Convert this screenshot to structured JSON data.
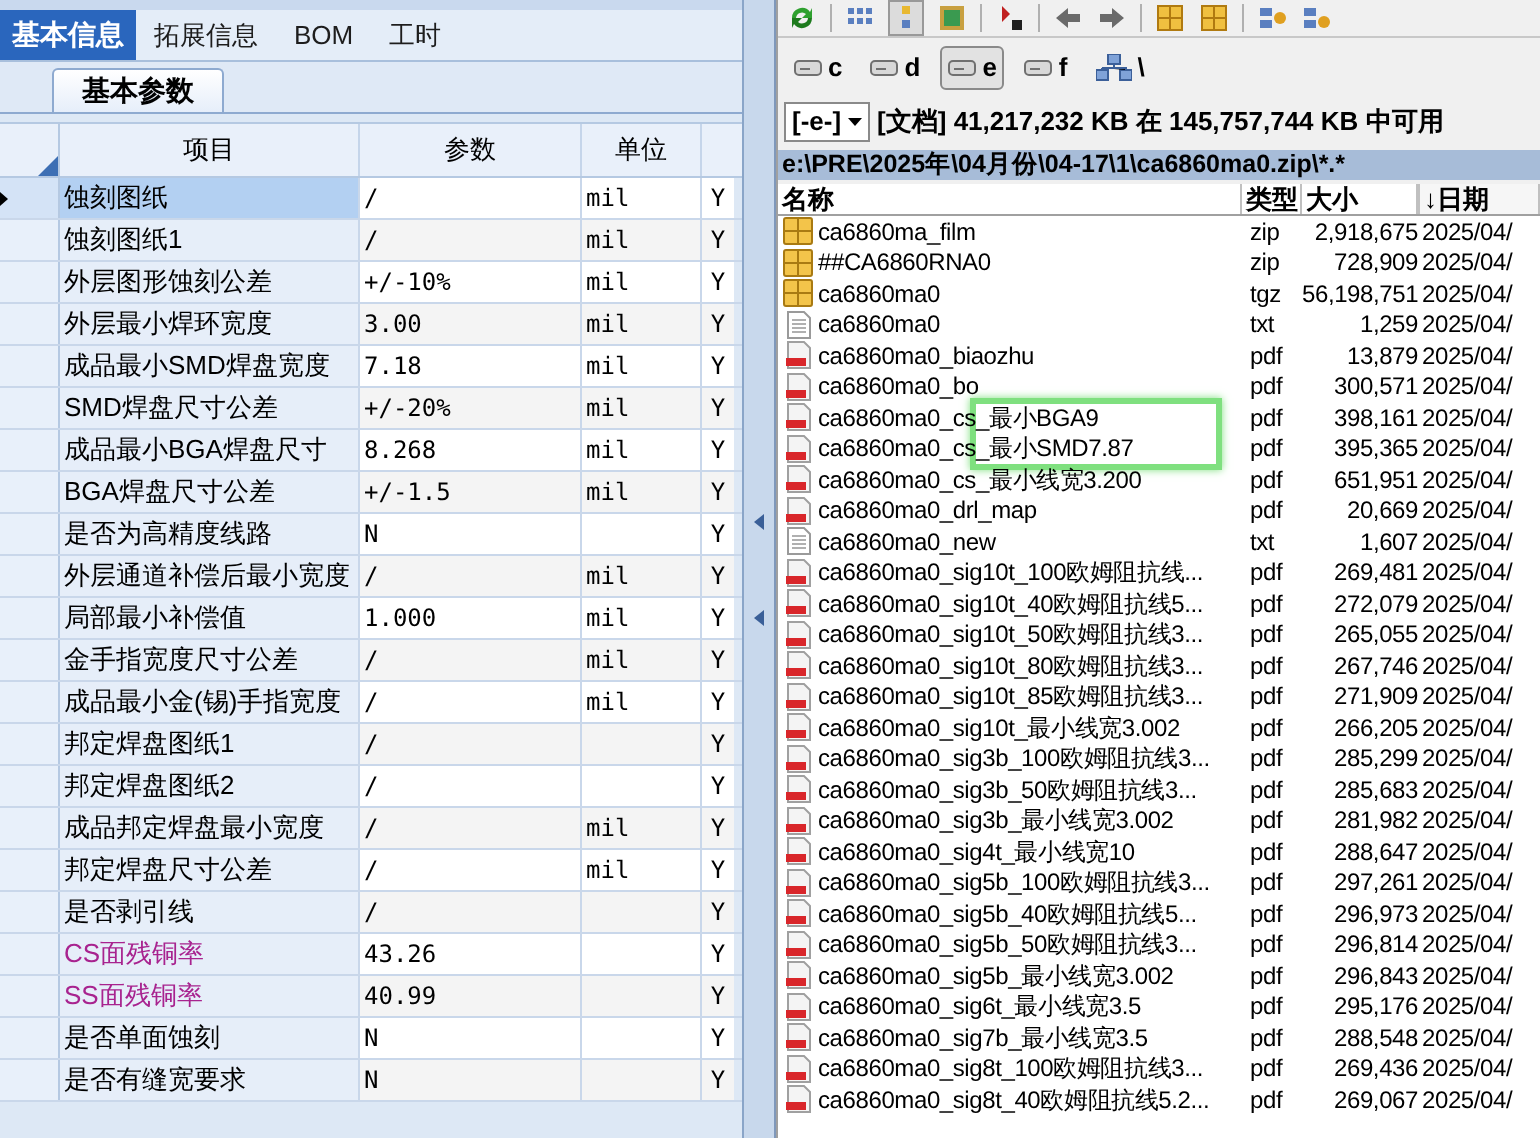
{
  "left_panel": {
    "tabs": [
      {
        "label": "基本信息",
        "selected": true
      },
      {
        "label": "拓展信息",
        "selected": false
      },
      {
        "label": "BOM",
        "selected": false
      },
      {
        "label": "工时",
        "selected": false
      }
    ],
    "subtabs": [
      {
        "label": "基本参数",
        "selected": true
      }
    ],
    "table": {
      "columns": [
        "项目",
        "参数",
        "单位"
      ],
      "rows": [
        {
          "item": "蚀刻图纸",
          "value": "/",
          "unit": "mil",
          "column_4": "Y",
          "color": "#000000",
          "selected": true
        },
        {
          "item": "蚀刻图纸1",
          "value": "/",
          "unit": "mil",
          "column_4": "Y",
          "color": "#000000",
          "selected": false
        },
        {
          "item": "外层图形蚀刻公差",
          "value": "+/-10%",
          "unit": "mil",
          "column_4": "Y",
          "color": "#000000",
          "selected": false
        },
        {
          "item": "外层最小焊环宽度",
          "value": "3.00",
          "unit": "mil",
          "column_4": "Y",
          "color": "#000000",
          "selected": false
        },
        {
          "item": "成品最小SMD焊盘宽度",
          "value": "7.18",
          "unit": "mil",
          "column_4": "Y",
          "color": "#000000",
          "selected": false
        },
        {
          "item": "SMD焊盘尺寸公差",
          "value": "+/-20%",
          "unit": "mil",
          "column_4": "Y",
          "color": "#000000",
          "selected": false
        },
        {
          "item": "成品最小BGA焊盘尺寸",
          "value": "8.268",
          "unit": "mil",
          "column_4": "Y",
          "color": "#000000",
          "selected": false
        },
        {
          "item": "BGA焊盘尺寸公差",
          "value": "+/-1.5",
          "unit": "mil",
          "column_4": "Y",
          "color": "#000000",
          "selected": false
        },
        {
          "item": "是否为高精度线路",
          "value": "N",
          "column_4": "Y",
          "color": "#000000",
          "selected": false
        },
        {
          "item": "外层通道补偿后最小宽度",
          "value": "/",
          "unit": "mil",
          "column_4": "Y",
          "color": "#000000",
          "selected": false
        },
        {
          "item": "局部最小补偿值",
          "value": "1.000",
          "unit": "mil",
          "column_4": "Y",
          "color": "#000000",
          "selected": false
        },
        {
          "item": "金手指宽度尺寸公差",
          "value": "/",
          "unit": "mil",
          "column_4": "Y",
          "color": "#000000",
          "selected": false
        },
        {
          "item": "成品最小金(锡)手指宽度",
          "value": "/",
          "unit": "mil",
          "column_4": "Y",
          "color": "#000000",
          "selected": false
        },
        {
          "item": "邦定焊盘图纸1",
          "value": "/",
          "column_4": "Y",
          "color": "#000000",
          "selected": false
        },
        {
          "item": "邦定焊盘图纸2",
          "value": "/",
          "column_4": "Y",
          "color": "#000000",
          "selected": false
        },
        {
          "item": "成品邦定焊盘最小宽度",
          "value": "/",
          "unit": "mil",
          "column_4": "Y",
          "color": "#000000",
          "selected": false
        },
        {
          "item": "邦定焊盘尺寸公差",
          "value": "/",
          "unit": "mil",
          "column_4": "Y",
          "color": "#000000",
          "selected": false
        },
        {
          "item": "是否剥引线",
          "value": "/",
          "column_4": "Y",
          "color": "#000000",
          "selected": false
        },
        {
          "item": "CS面残铜率",
          "value": "43.26",
          "column_4": "Y",
          "color": "#a8238f",
          "selected": false
        },
        {
          "item": "SS面残铜率",
          "value": "40.99",
          "column_4": "Y",
          "color": "#a8238f",
          "selected": false
        },
        {
          "item": "是否单面蚀刻",
          "value": "N",
          "column_4": "Y",
          "color": "#000000",
          "selected": false
        },
        {
          "item": "是否有缝宽要求",
          "value": "N",
          "column_4": "Y",
          "color": "#000000",
          "selected": false
        }
      ]
    }
  },
  "right_panel": {
    "drives": [
      {
        "label": "c",
        "kind": "drive",
        "selected": false
      },
      {
        "label": "d",
        "kind": "drive",
        "selected": false
      },
      {
        "label": "e",
        "kind": "drive",
        "selected": true
      },
      {
        "label": "f",
        "kind": "drive",
        "selected": false
      },
      {
        "label": "\\",
        "kind": "network",
        "selected": false
      }
    ],
    "drive_dropdown": "[-e-]",
    "free_space": "[文档] 41,217,232 KB 在 145,757,744 KB 中可用",
    "path": "e:\\PRE\\2025年\\04月份\\04-17\\1\\ca6860ma0.zip\\*.*",
    "columns": [
      "名称",
      "类型",
      "大小",
      "↓日期"
    ],
    "files": [
      {
        "kind": "zip",
        "name": "ca6860ma_film",
        "type": "zip",
        "size": "2,918,675",
        "date": "2025/04/"
      },
      {
        "kind": "zip",
        "name": "##CA6860RNA0",
        "type": "zip",
        "size": "728,909",
        "date": "2025/04/"
      },
      {
        "kind": "zip",
        "name": "ca6860ma0",
        "type": "tgz",
        "size": "56,198,751",
        "date": "2025/04/"
      },
      {
        "kind": "txt",
        "name": "ca6860ma0",
        "type": "txt",
        "size": "1,259",
        "date": "2025/04/"
      },
      {
        "kind": "pdf",
        "name": "ca6860ma0_biaozhu",
        "type": "pdf",
        "size": "13,879",
        "date": "2025/04/"
      },
      {
        "kind": "pdf",
        "name": "ca6860ma0_bo",
        "type": "pdf",
        "size": "300,571",
        "date": "2025/04/"
      },
      {
        "kind": "pdf",
        "name": "ca6860ma0_cs_最小BGA9",
        "type": "pdf",
        "size": "398,161",
        "date": "2025/04/"
      },
      {
        "kind": "pdf",
        "name": "ca6860ma0_cs_最小SMD7.87",
        "type": "pdf",
        "size": "395,365",
        "date": "2025/04/"
      },
      {
        "kind": "pdf",
        "name": "ca6860ma0_cs_最小线宽3.200",
        "type": "pdf",
        "size": "651,951",
        "date": "2025/04/"
      },
      {
        "kind": "pdf",
        "name": "ca6860ma0_drl_map",
        "type": "pdf",
        "size": "20,669",
        "date": "2025/04/"
      },
      {
        "kind": "txt",
        "name": "ca6860ma0_new",
        "type": "txt",
        "size": "1,607",
        "date": "2025/04/"
      },
      {
        "kind": "pdf",
        "name": "ca6860ma0_sig10t_100欧姆阻抗线...",
        "type": "pdf",
        "size": "269,481",
        "date": "2025/04/"
      },
      {
        "kind": "pdf",
        "name": "ca6860ma0_sig10t_40欧姆阻抗线5...",
        "type": "pdf",
        "size": "272,079",
        "date": "2025/04/"
      },
      {
        "kind": "pdf",
        "name": "ca6860ma0_sig10t_50欧姆阻抗线3...",
        "type": "pdf",
        "size": "265,055",
        "date": "2025/04/"
      },
      {
        "kind": "pdf",
        "name": "ca6860ma0_sig10t_80欧姆阻抗线3...",
        "type": "pdf",
        "size": "267,746",
        "date": "2025/04/"
      },
      {
        "kind": "pdf",
        "name": "ca6860ma0_sig10t_85欧姆阻抗线3...",
        "type": "pdf",
        "size": "271,909",
        "date": "2025/04/"
      },
      {
        "kind": "pdf",
        "name": "ca6860ma0_sig10t_最小线宽3.002",
        "type": "pdf",
        "size": "266,205",
        "date": "2025/04/"
      },
      {
        "kind": "pdf",
        "name": "ca6860ma0_sig3b_100欧姆阻抗线3...",
        "type": "pdf",
        "size": "285,299",
        "date": "2025/04/"
      },
      {
        "kind": "pdf",
        "name": "ca6860ma0_sig3b_50欧姆阻抗线3...",
        "type": "pdf",
        "size": "285,683",
        "date": "2025/04/"
      },
      {
        "kind": "pdf",
        "name": "ca6860ma0_sig3b_最小线宽3.002",
        "type": "pdf",
        "size": "281,982",
        "date": "2025/04/"
      },
      {
        "kind": "pdf",
        "name": "ca6860ma0_sig4t_最小线宽10",
        "type": "pdf",
        "size": "288,647",
        "date": "2025/04/"
      },
      {
        "kind": "pdf",
        "name": "ca6860ma0_sig5b_100欧姆阻抗线3...",
        "type": "pdf",
        "size": "297,261",
        "date": "2025/04/"
      },
      {
        "kind": "pdf",
        "name": "ca6860ma0_sig5b_40欧姆阻抗线5...",
        "type": "pdf",
        "size": "296,973",
        "date": "2025/04/"
      },
      {
        "kind": "pdf",
        "name": "ca6860ma0_sig5b_50欧姆阻抗线3...",
        "type": "pdf",
        "size": "296,814",
        "date": "2025/04/"
      },
      {
        "kind": "pdf",
        "name": "ca6860ma0_sig5b_最小线宽3.002",
        "type": "pdf",
        "size": "296,843",
        "date": "2025/04/"
      },
      {
        "kind": "pdf",
        "name": "ca6860ma0_sig6t_最小线宽3.5",
        "type": "pdf",
        "size": "295,176",
        "date": "2025/04/"
      },
      {
        "kind": "pdf",
        "name": "ca6860ma0_sig7b_最小线宽3.5",
        "type": "pdf",
        "size": "288,548",
        "date": "2025/04/"
      },
      {
        "kind": "pdf",
        "name": "ca6860ma0_sig8t_100欧姆阻抗线3...",
        "type": "pdf",
        "size": "269,436",
        "date": "2025/04/"
      },
      {
        "kind": "pdf",
        "name": "ca6860ma0_sig8t_40欧姆阻抗线5.2...",
        "type": "pdf",
        "size": "269,067",
        "date": "2025/04/"
      }
    ]
  }
}
